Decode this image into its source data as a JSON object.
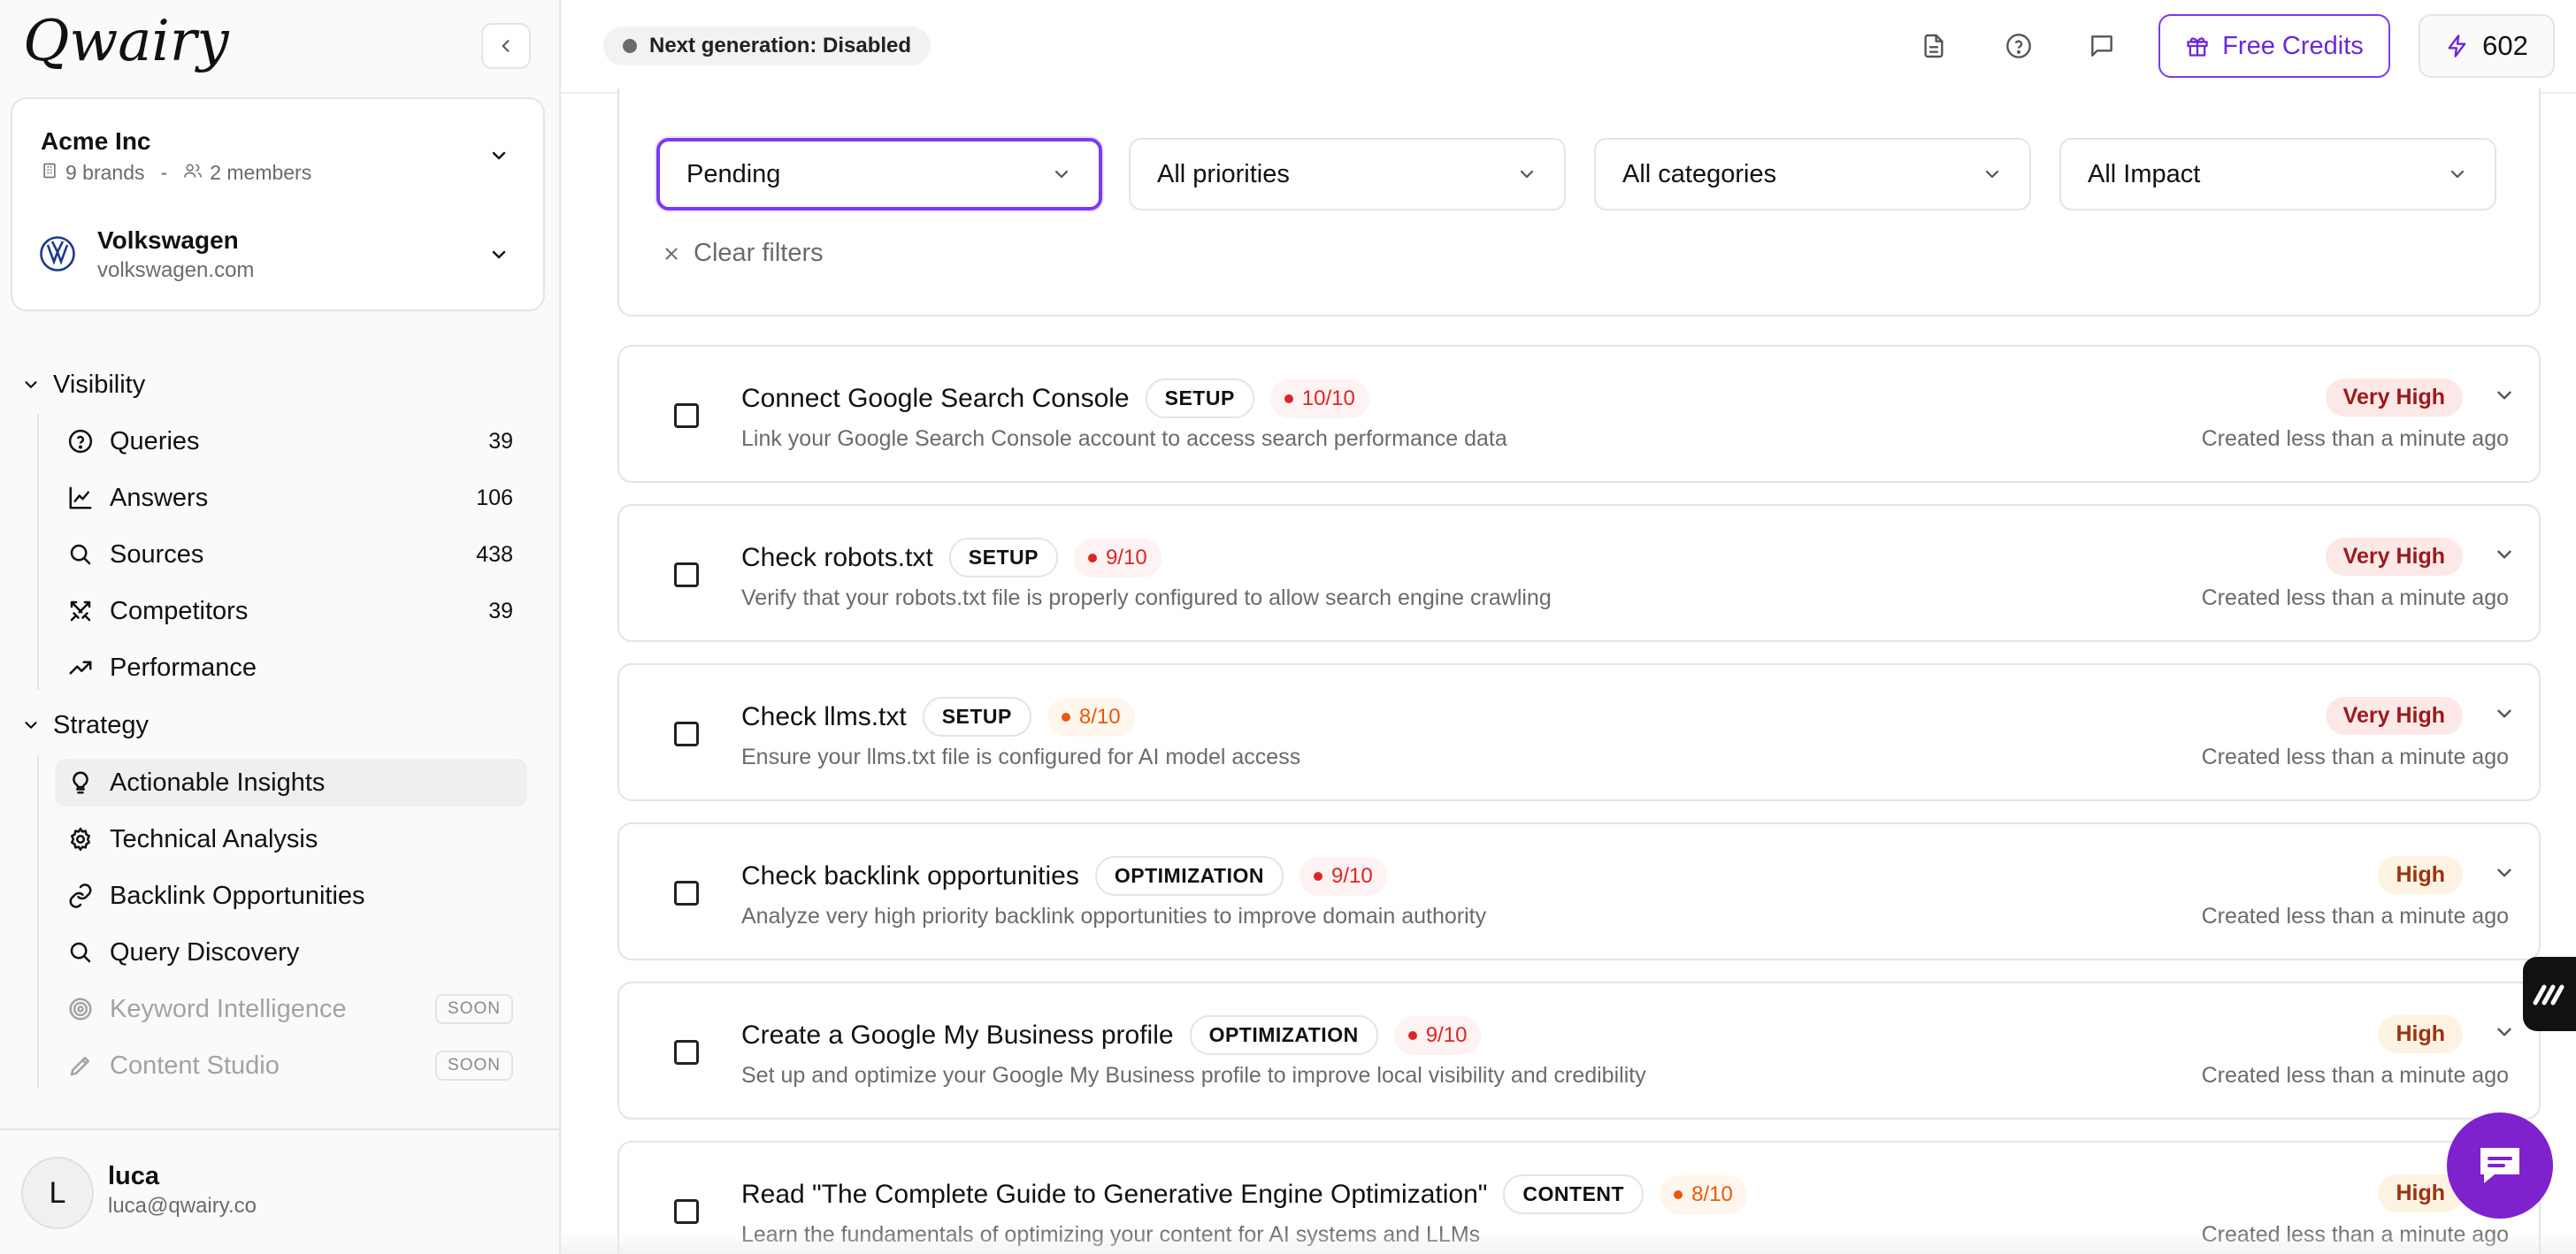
{
  "brand": {
    "logo_text": "Qwairy"
  },
  "sidebar": {
    "org": {
      "name": "Acme Inc",
      "brands": "9 brands",
      "separator": "-",
      "members": "2 members"
    },
    "brand": {
      "name": "Volkswagen",
      "domain": "volkswagen.com"
    },
    "sections": [
      {
        "label": "Visibility",
        "items": [
          {
            "label": "Queries",
            "count": "39",
            "icon": "help-circle-icon"
          },
          {
            "label": "Answers",
            "count": "106",
            "icon": "line-chart-icon"
          },
          {
            "label": "Sources",
            "count": "438",
            "icon": "search-icon"
          },
          {
            "label": "Competitors",
            "count": "39",
            "icon": "swords-icon"
          },
          {
            "label": "Performance",
            "count": "",
            "icon": "trending-up-icon"
          }
        ]
      },
      {
        "label": "Strategy",
        "items": [
          {
            "label": "Actionable Insights",
            "icon": "lightbulb-icon",
            "active": true
          },
          {
            "label": "Technical Analysis",
            "icon": "gear-icon"
          },
          {
            "label": "Backlink Opportunities",
            "icon": "link-icon"
          },
          {
            "label": "Query Discovery",
            "icon": "search-icon"
          },
          {
            "label": "Keyword Intelligence",
            "icon": "target-icon",
            "badge": "SOON"
          },
          {
            "label": "Content Studio",
            "icon": "pen-icon",
            "badge": "SOON"
          }
        ]
      }
    ],
    "user": {
      "initial": "L",
      "name": "luca",
      "email": "luca@qwairy.co"
    }
  },
  "topbar": {
    "generation_status": "Next generation: Disabled",
    "free_credits_label": "Free Credits",
    "credit_balance": "602"
  },
  "filters": {
    "status": "Pending",
    "priority": "All priorities",
    "category": "All categories",
    "impact": "All Impact",
    "clear_label": "Clear filters"
  },
  "insights": [
    {
      "title": "Connect Google Search Console",
      "tag": "SETUP",
      "score": "10/10",
      "score_level": "red",
      "description": "Link your Google Search Console account to access search performance data",
      "impact": "Very High",
      "created": "Created less than a minute ago"
    },
    {
      "title": "Check robots.txt",
      "tag": "SETUP",
      "score": "9/10",
      "score_level": "red",
      "description": "Verify that your robots.txt file is properly configured to allow search engine crawling",
      "impact": "Very High",
      "created": "Created less than a minute ago"
    },
    {
      "title": "Check llms.txt",
      "tag": "SETUP",
      "score": "8/10",
      "score_level": "orange",
      "description": "Ensure your llms.txt file is configured for AI model access",
      "impact": "Very High",
      "created": "Created less than a minute ago"
    },
    {
      "title": "Check backlink opportunities",
      "tag": "OPTIMIZATION",
      "score": "9/10",
      "score_level": "red",
      "description": "Analyze very high priority backlink opportunities to improve domain authority",
      "impact": "High",
      "created": "Created less than a minute ago"
    },
    {
      "title": "Create a Google My Business profile",
      "tag": "OPTIMIZATION",
      "score": "9/10",
      "score_level": "red",
      "description": "Set up and optimize your Google My Business profile to improve local visibility and credibility",
      "impact": "High",
      "created": "Created less than a minute ago"
    },
    {
      "title": "Read \"The Complete Guide to Generative Engine Optimization\"",
      "tag": "CONTENT",
      "score": "8/10",
      "score_level": "orange",
      "description": "Learn the fundamentals of optimizing your content for AI systems and LLMs",
      "impact": "High",
      "created": "Created less than a minute ago"
    }
  ],
  "colors": {
    "accent": "#7c3aed",
    "chat_fab": "#7e22ce",
    "very_high_bg": "#fde8e8",
    "high_bg": "#fef3e2",
    "score_red": "#dc2626",
    "score_orange": "#ea580c"
  }
}
